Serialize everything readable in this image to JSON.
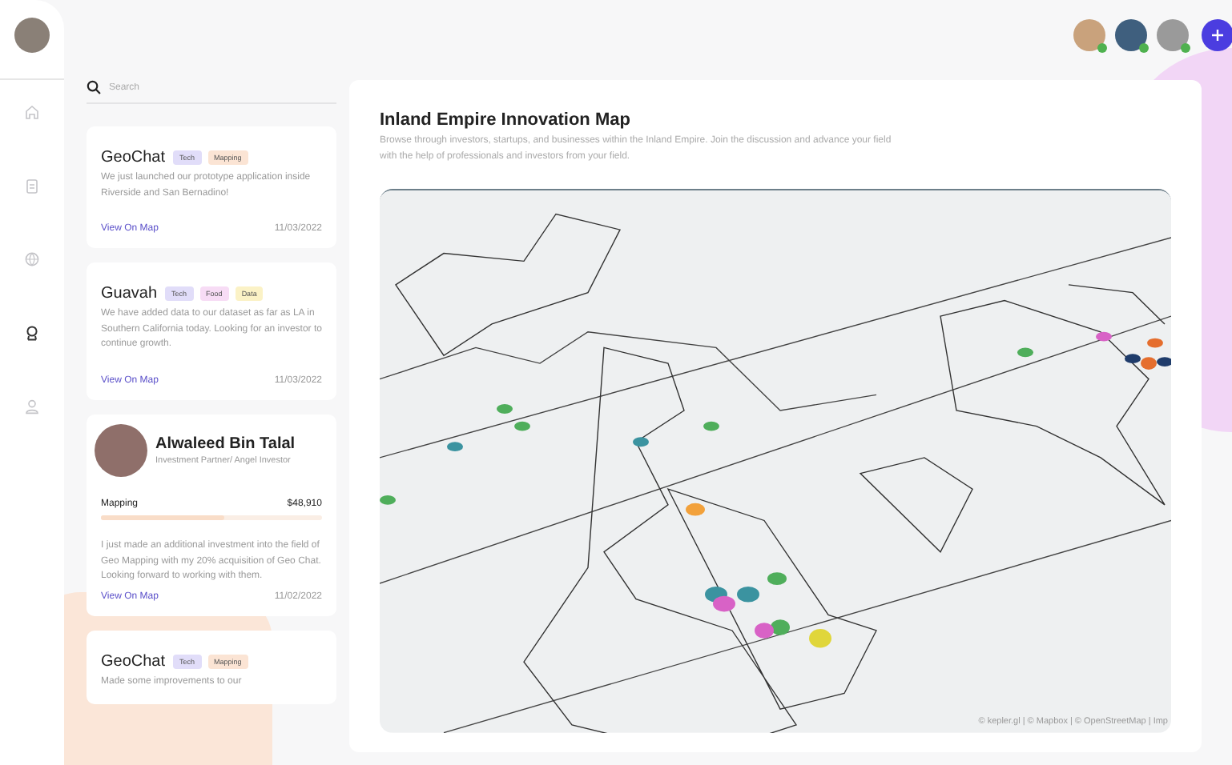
{
  "sidebar": {
    "items": [
      {
        "kind": "home",
        "selected": false
      },
      {
        "kind": "clipboard",
        "selected": false
      },
      {
        "kind": "globe",
        "selected": false
      },
      {
        "kind": "award",
        "selected": true
      },
      {
        "kind": "user",
        "selected": false
      }
    ]
  },
  "header": {
    "users": [
      {
        "online": true
      },
      {
        "online": true
      },
      {
        "online": true
      }
    ]
  },
  "search": {
    "placeholder": "Search"
  },
  "feed": [
    {
      "kind": "post",
      "title": "GeoChat",
      "tags": [
        {
          "label": "Tech",
          "color": "#e1ddf9"
        },
        {
          "label": "Mapping",
          "color": "#fbe4d4"
        }
      ],
      "text": "We just launched our prototype application inside Riverside and San Bernadino!",
      "link": "View On Map",
      "date": "11/03/2022"
    },
    {
      "kind": "post",
      "title": "Guavah",
      "tags": [
        {
          "label": "Tech",
          "color": "#e1ddf9"
        },
        {
          "label": "Food",
          "color": "#f7dcf5"
        },
        {
          "label": "Data",
          "color": "#fbf2c6"
        }
      ],
      "text": "We have added data to our dataset as far as LA in Southern California today. Looking for an investor to continue growth.",
      "link": "View On Map",
      "date": "11/03/2022"
    },
    {
      "kind": "investment",
      "name": "Alwaleed Bin Talal",
      "role": "Investment Partner/ Angel Investor",
      "field": "Mapping",
      "amount": "$48,910",
      "level": 0.56,
      "text": "I just made an additional investment into the field of Geo Mapping with my 20% acquisition of Geo Chat. Looking forward to working with them.",
      "link": "View On Map",
      "date": "11/02/2022"
    },
    {
      "kind": "post",
      "title": "GeoChat",
      "tags": [
        {
          "label": "Tech",
          "color": "#e1ddf9"
        },
        {
          "label": "Mapping",
          "color": "#fbe4d4"
        }
      ],
      "text": "Made some improvements to our"
    }
  ],
  "main": {
    "title": "Inland Empire Innovation Map",
    "description": "Browse through investors, startups, and businesses within the Inland Empire. Join the discussion and advance your field with the help of professionals and investors from your field.",
    "map": {
      "attribution": "© kepler.gl | © Mapbox | © OpenStreetMap | Imp"
    }
  }
}
